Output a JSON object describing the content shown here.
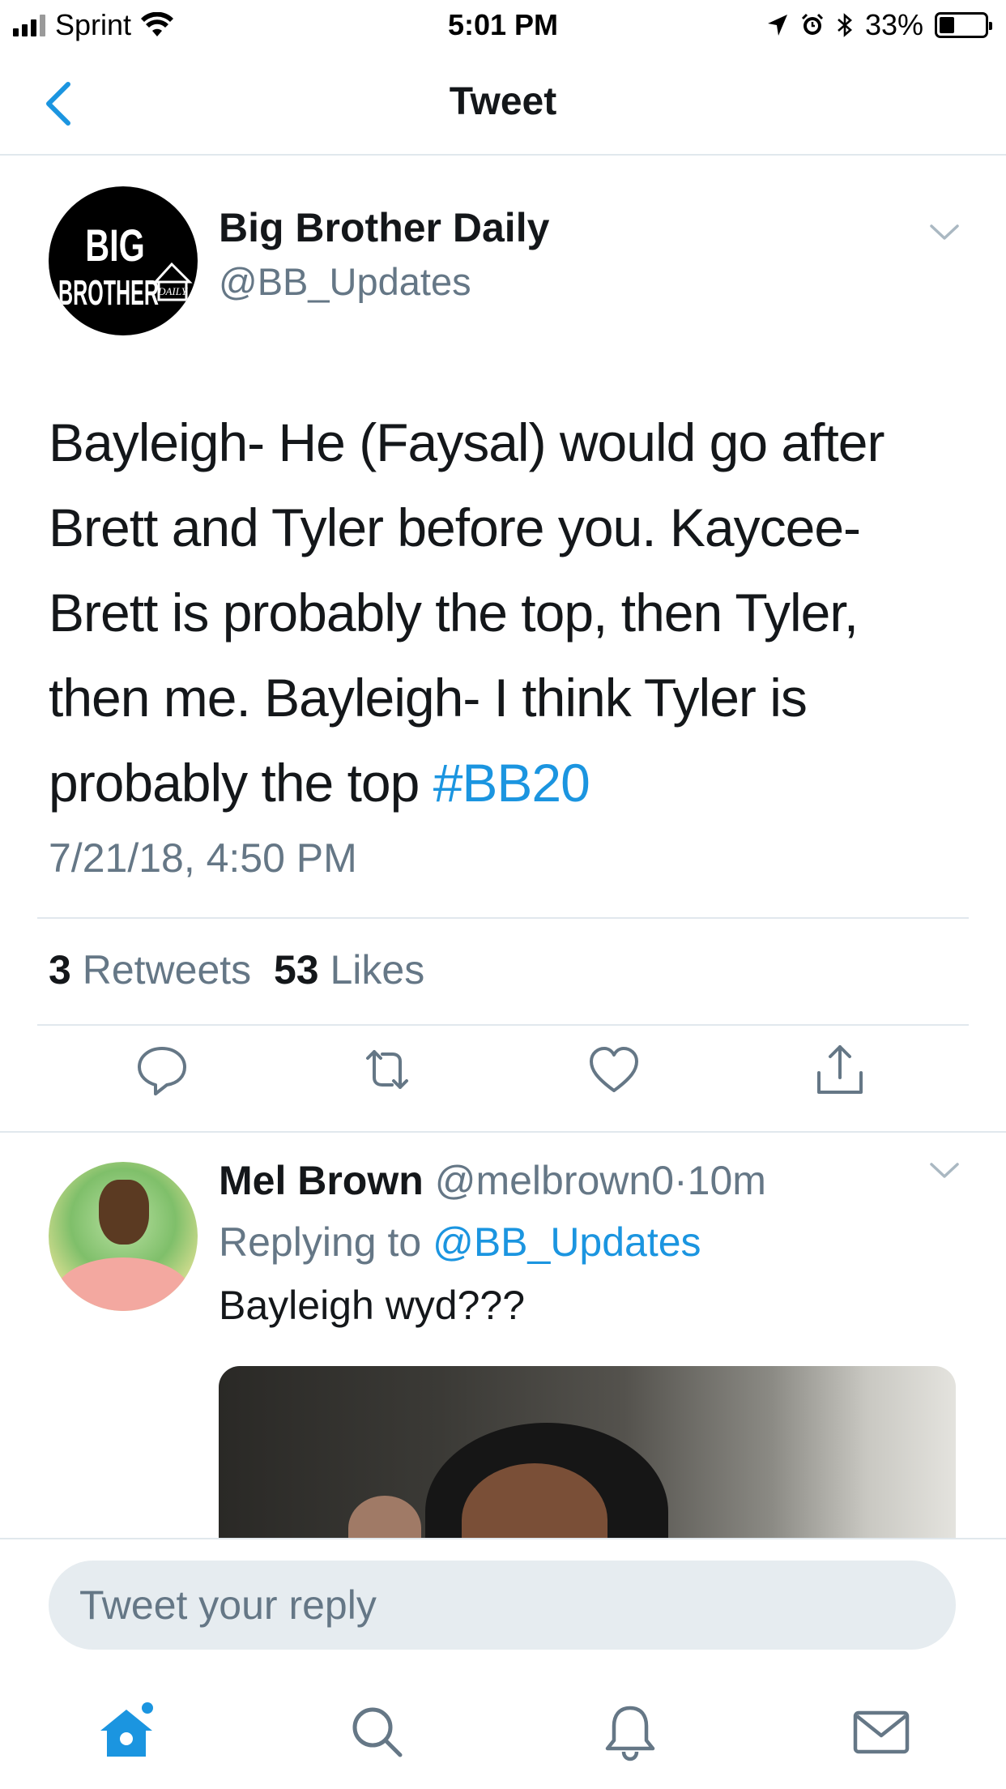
{
  "status_bar": {
    "carrier": "Sprint",
    "time": "5:01 PM",
    "battery": "33%",
    "battery_level": 0.33
  },
  "nav": {
    "title": "Tweet"
  },
  "tweet": {
    "author_name": "Big Brother Daily",
    "author_handle": "@BB_Updates",
    "avatar_lines": [
      "BIG",
      "BROTHER",
      "DAILY"
    ],
    "text": "Bayleigh- He (Faysal) would go after Brett and Tyler before you. Kaycee- Brett is probably the top, then Tyler, then me. Bayleigh- I think Tyler is probably the top ",
    "hashtag": "#BB20",
    "timestamp": "7/21/18, 4:50 PM",
    "retweet_count": "3",
    "retweet_label": "Retweets",
    "like_count": "53",
    "like_label": "Likes"
  },
  "reply": {
    "author_name": "Mel Brown",
    "author_handle": "@melbrown0",
    "separator": "·",
    "age": "10m",
    "replying_prefix": "Replying to",
    "replying_to": "@BB_Updates",
    "text": "Bayleigh wyd???"
  },
  "composer": {
    "placeholder": "Tweet your reply"
  },
  "icons": {
    "back": "chevron-left-icon",
    "more": "chevron-down-icon",
    "reply": "comment-icon",
    "retweet": "retweet-icon",
    "like": "heart-icon",
    "share": "share-icon",
    "home": "home-icon",
    "search": "search-icon",
    "notifications": "bell-icon",
    "messages": "mail-icon"
  },
  "colors": {
    "accent": "#1b95e0",
    "secondary_text": "#657786",
    "divider": "#e1e8ed"
  }
}
